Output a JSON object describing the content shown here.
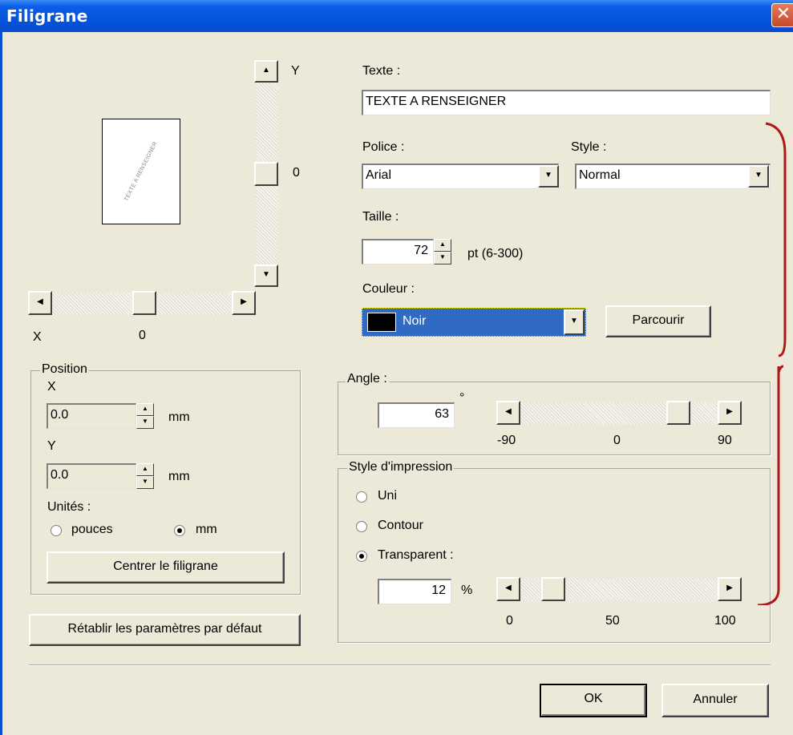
{
  "window": {
    "title": "Filigrane",
    "close_glyph": "✕"
  },
  "preview": {
    "page_text": "TEXTE A RENSEIGNER",
    "y_axis_label": "Y",
    "y_value": "0",
    "x_axis_label": "X",
    "x_value": "0"
  },
  "text": {
    "label": "Texte :",
    "value": "TEXTE A RENSEIGNER"
  },
  "font": {
    "label": "Police :",
    "value": "Arial"
  },
  "style": {
    "label": "Style :",
    "value": "Normal"
  },
  "size": {
    "label": "Taille :",
    "value": "72",
    "range": "pt (6-300)"
  },
  "color": {
    "label": "Couleur :",
    "value": "Noir",
    "swatch": "#000000",
    "browse_label": "Parcourir"
  },
  "angle": {
    "group_title": "Angle :",
    "value": "63",
    "unit": "°",
    "ticks": [
      "-90",
      "0",
      "90"
    ],
    "slider_value": 63
  },
  "print_style": {
    "group_title": "Style d'impression",
    "options": [
      "Uni",
      "Contour",
      "Transparent :"
    ],
    "selected": "Transparent :",
    "transparency_value": "12",
    "transparency_unit": "%",
    "ticks": [
      "0",
      "50",
      "100"
    ],
    "slider_value": 12
  },
  "position": {
    "group_title": "Position",
    "x_label": "X",
    "x_value": "0.0",
    "y_label": "Y",
    "y_value": "0.0",
    "unit": "mm",
    "units_label": "Unités :",
    "unit_options": [
      "pouces",
      "mm"
    ],
    "unit_selected": "mm",
    "center_button": "Centrer le filigrane"
  },
  "reset_button": "Rétablir les paramètres par défaut",
  "ok_button": "OK",
  "cancel_button": "Annuler",
  "annotation_color": "#b01818"
}
